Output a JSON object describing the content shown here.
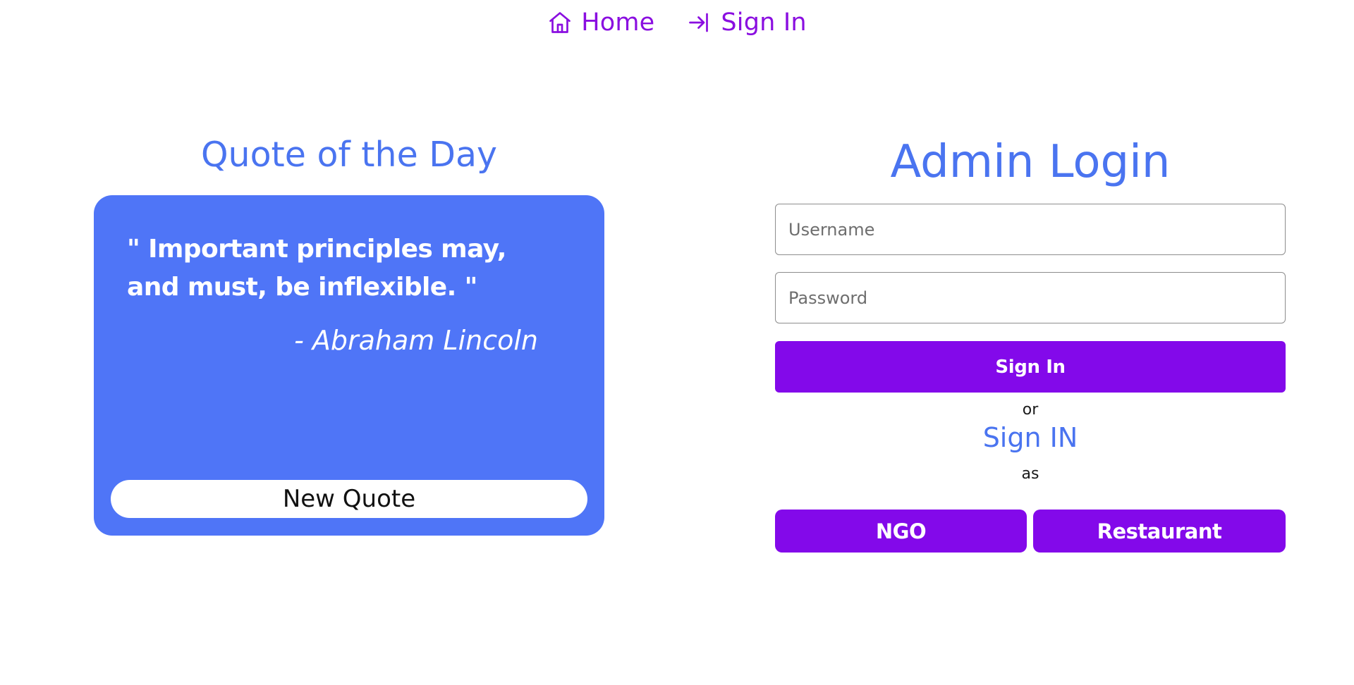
{
  "nav": {
    "home_label": "Home",
    "home_icon": "home-icon",
    "signin_label": "Sign In",
    "signin_icon": "sign-in-icon",
    "link_color": "#8a0ee0"
  },
  "quote_section": {
    "title": "Quote of the Day",
    "quote_text": "\" Important principles may, and must, be inflexible. \"",
    "author": "- Abraham Lincoln",
    "new_quote_label": "New Quote",
    "card_color": "#4f75f7"
  },
  "login": {
    "title": "Admin Login",
    "username_placeholder": "Username",
    "username_value": "",
    "password_placeholder": "Password",
    "password_value": "",
    "signin_label": "Sign In",
    "or_text": "or",
    "signin_as_title": "Sign IN",
    "as_text": "as",
    "ngo_label": "NGO",
    "restaurant_label": "Restaurant",
    "button_color": "#8309ea",
    "heading_color": "#4a74f0"
  }
}
